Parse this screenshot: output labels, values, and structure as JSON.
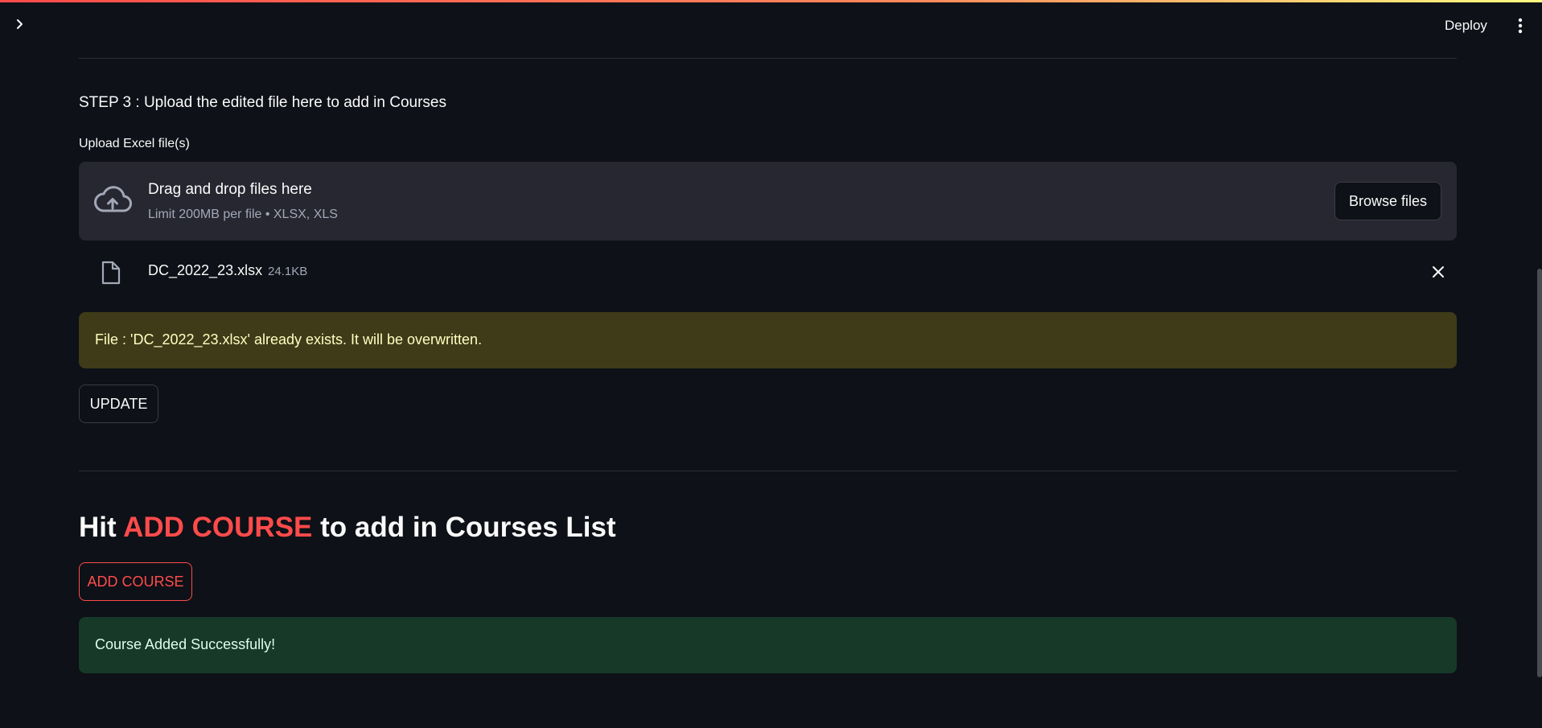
{
  "colors": {
    "background": "#0e1117",
    "accent": "#ff4b4b",
    "warning_bg": "#3f3b18",
    "warning_text": "#ffffc2",
    "success_bg": "#173928",
    "success_text": "#dffde9",
    "dropzone_bg": "#262730"
  },
  "header": {
    "sidebar_toggle_icon": "chevron-right-icon",
    "deploy_label": "Deploy",
    "menu_icon": "vertical-dots-icon"
  },
  "step3": {
    "text": "STEP 3 : Upload the edited file here to add in Courses"
  },
  "uploader": {
    "label": "Upload Excel file(s)",
    "icon": "cloud-upload-icon",
    "title": "Drag and drop files here",
    "subtitle": "Limit 200MB per file • XLSX, XLS",
    "browse_label": "Browse files"
  },
  "uploaded_file": {
    "icon": "file-icon",
    "name": "DC_2022_23.xlsx",
    "size": "24.1KB",
    "remove_icon": "close-icon"
  },
  "warning": {
    "message": "File : 'DC_2022_23.xlsx' already exists. It will be overwritten."
  },
  "update_button": {
    "label": "UPDATE"
  },
  "add_section": {
    "heading_prefix": "Hit ",
    "heading_accent": "ADD COURSE",
    "heading_suffix": " to add in Courses List",
    "button_label": "ADD COURSE"
  },
  "success": {
    "message": "Course Added Successfully!"
  }
}
